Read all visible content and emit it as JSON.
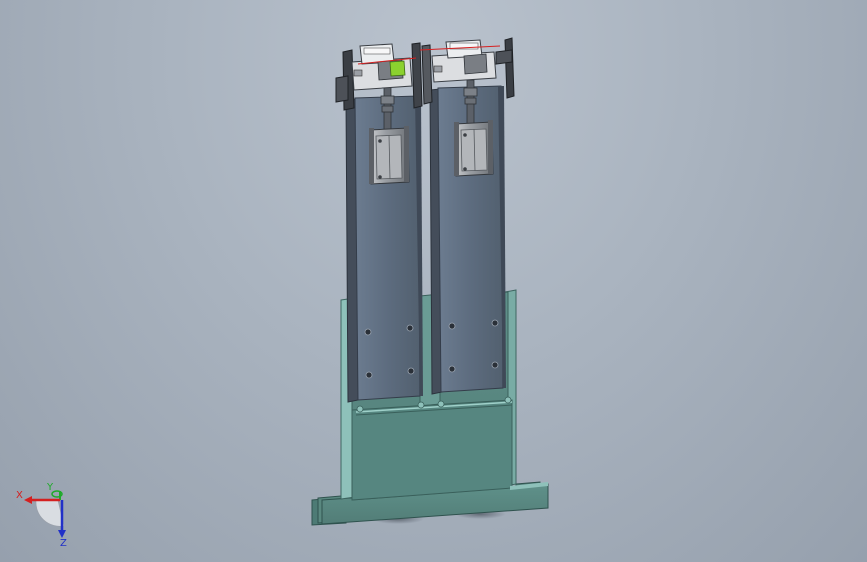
{
  "app": {
    "view": "3d-graphics-area"
  },
  "colors": {
    "background_top": "#b9c2cd",
    "background_bottom": "#96a0ad",
    "base_plate": "#5a8880",
    "base_plate_edge": "#3e6661",
    "base_plate_light": "#8fc3bb",
    "slide_plate": "#5e6d80",
    "slide_plate_edge": "#3b4656",
    "metal_light": "#d7d9dc",
    "metal_dark": "#4a4d52",
    "cylinder": "#8d9196",
    "accent_green": "#8bd12f",
    "sensor_line": "#d62020",
    "axis_x": "#d42020",
    "axis_y": "#1faa2a",
    "axis_z": "#2130c8"
  },
  "icons": {
    "triad": "coordinate-triad-icon"
  },
  "triad": {
    "x_label": "X",
    "y_label": "Y",
    "z_label": "Z"
  }
}
